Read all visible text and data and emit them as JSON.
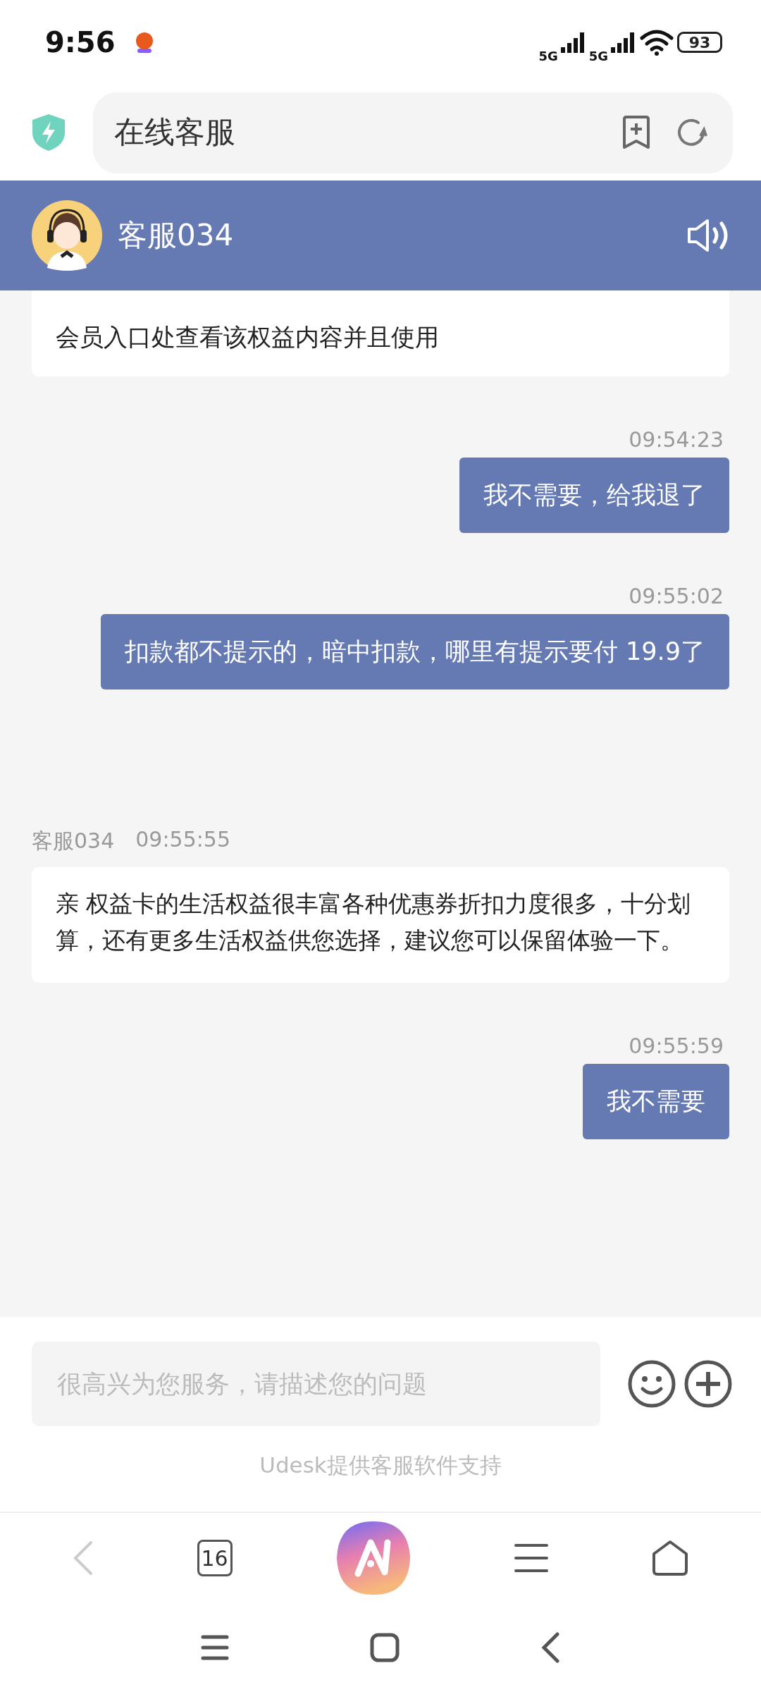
{
  "status_bar": {
    "time": "9:56",
    "networks": [
      "5G",
      "5G"
    ],
    "battery": "93"
  },
  "address_bar": {
    "title": "在线客服"
  },
  "chat_header": {
    "agent_name": "客服034"
  },
  "messages": [
    {
      "kind": "agent_partial",
      "text": "会员入口处查看该权益内容并且使用"
    },
    {
      "kind": "user",
      "time": "09:54:23",
      "text": "我不需要，给我退了"
    },
    {
      "kind": "user",
      "time": "09:55:02",
      "text": "扣款都不提示的，暗中扣款，哪里有提示要付 19.9了"
    },
    {
      "kind": "agent",
      "sender": "客服034",
      "time": "09:55:55",
      "text": "亲 权益卡的生活权益很丰富各种优惠券折扣力度很多，十分划算，还有更多生活权益供您选择，建议您可以保留体验一下。"
    },
    {
      "kind": "user",
      "time": "09:55:59",
      "text": "我不需要"
    }
  ],
  "composer": {
    "placeholder": "很高兴为您服务，请描述您的问题"
  },
  "powered_by": "Udesk提供客服软件支持",
  "browser_toolbar": {
    "tab_count": "16"
  }
}
